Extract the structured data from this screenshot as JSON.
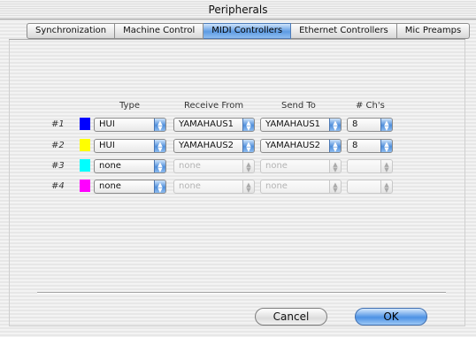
{
  "window": {
    "title": "Peripherals"
  },
  "tabs": [
    {
      "label": "Synchronization",
      "active": false
    },
    {
      "label": "Machine Control",
      "active": false
    },
    {
      "label": "MIDI Controllers",
      "active": true
    },
    {
      "label": "Ethernet Controllers",
      "active": false
    },
    {
      "label": "Mic Preamps",
      "active": false
    }
  ],
  "columns": {
    "type": "Type",
    "receive": "Receive From",
    "send": "Send To",
    "channels": "# Ch's"
  },
  "rows": [
    {
      "label": "#1",
      "color": "#0000ff",
      "type": "HUI",
      "receive": "YAMAHAUS1",
      "send": "YAMAHAUS1",
      "channels": "8",
      "enabled": true
    },
    {
      "label": "#2",
      "color": "#ffff00",
      "type": "HUI",
      "receive": "YAMAHAUS2",
      "send": "YAMAHAUS2",
      "channels": "8",
      "enabled": true
    },
    {
      "label": "#3",
      "color": "#00ffff",
      "type": "none",
      "receive": "none",
      "send": "none",
      "channels": "",
      "enabled": false
    },
    {
      "label": "#4",
      "color": "#ff00ff",
      "type": "none",
      "receive": "none",
      "send": "none",
      "channels": "",
      "enabled": false
    }
  ],
  "buttons": {
    "cancel": "Cancel",
    "ok": "OK"
  }
}
